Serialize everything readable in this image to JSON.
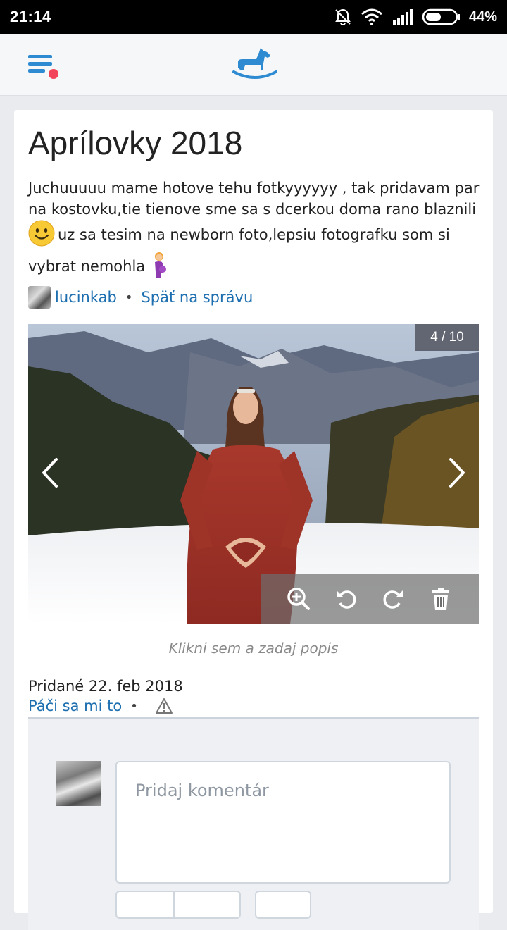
{
  "status_bar": {
    "time": "21:14",
    "battery_percent": "44%",
    "icons": [
      "bell-muted-icon",
      "wifi-icon",
      "signal-icon",
      "battery-icon"
    ]
  },
  "app_bar": {
    "menu_icon": "menu-list-icon",
    "notification_dot_color": "#f2445a",
    "logo": "rocking-horse-logo",
    "accent_color": "#2f8bd1"
  },
  "post": {
    "title": "Aprílovky 2018",
    "description_part1": "Juchuuuuu mame hotove tehu fotkyyyyyy , tak pridavam par na kostovku,tie tienove sme sa s dcerkou doma rano blaznili",
    "description_part2": "uz sa tesim na newborn foto,lepsiu fotografku som si vybrat nemohla",
    "author": "lucinkab",
    "back_link": "Späť na správu"
  },
  "gallery": {
    "counter": "4 / 10",
    "current": 4,
    "total": 10,
    "tools": [
      "zoom-in-icon",
      "rotate-left-icon",
      "rotate-right-icon",
      "trash-icon"
    ]
  },
  "caption_hint": "Klikni sem a zadaj popis",
  "added_text": "Pridané 22. feb 2018",
  "like_link": "Páči sa mi to",
  "comment": {
    "placeholder": "Pridaj komentár"
  }
}
